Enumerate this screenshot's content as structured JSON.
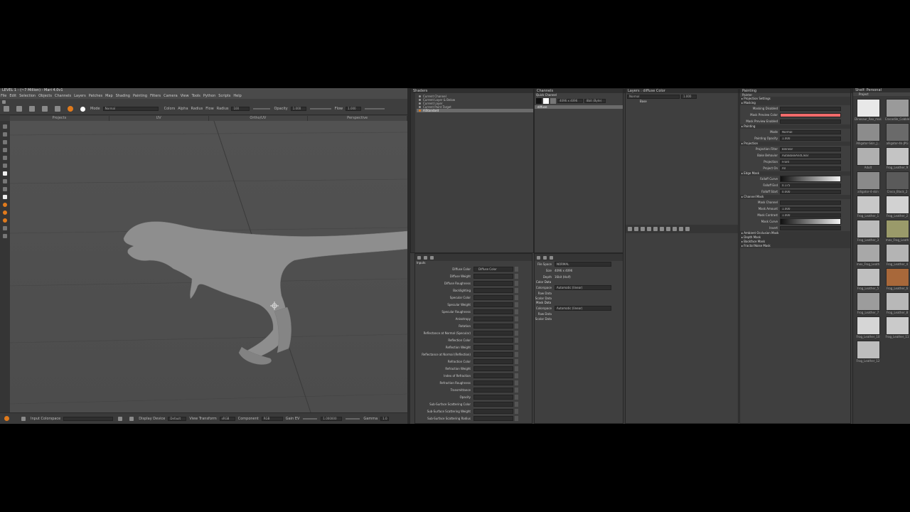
{
  "window": {
    "title": "LEVEL 1 - (~7 Million) - Mari 4.0v1"
  },
  "menu": [
    "File",
    "Edit",
    "Selection",
    "Objects",
    "Channels",
    "Layers",
    "Patches",
    "Map",
    "Shading",
    "Painting",
    "Filters",
    "Camera",
    "View",
    "Tools",
    "Python",
    "Scripts",
    "Help"
  ],
  "toolbar": {
    "mode_label": "Mode",
    "mode_value": "Normal",
    "colors_label": "Colors",
    "alpha_label": "Alpha",
    "radius_toggle_label": "Radius",
    "flow_toggle_label": "Flow",
    "radius_label": "Radius",
    "radius_value": "100",
    "opacity_label": "Opacity",
    "opacity_value": "1.000",
    "flow_label": "Flow",
    "flow_value": "1.000"
  },
  "view_tabs": [
    "Projects",
    "UV",
    "Ortho/UV",
    "Perspective"
  ],
  "statusbar": {
    "input_colorspace_label": "Input Colorspace",
    "display_device_label": "Display Device",
    "display_device_value": "Default",
    "view_transform_label": "View Transform",
    "view_transform_value": "sRGB",
    "component_label": "Component",
    "component_value": "RGB",
    "gain_label": "Gain EV",
    "gain_value": "1.000000",
    "gamma_label": "Gamma",
    "gamma_value": "1.0"
  },
  "shaders_panel": {
    "title": "Shaders",
    "items": [
      "Current Channel",
      "Current Layer & Below",
      "Current Layer",
      "Current Paint Target",
      "AiStandard"
    ],
    "selected_index": 4
  },
  "properties": {
    "section": "Inputs",
    "rows": [
      {
        "label": "Diffuse Color",
        "value": "Diffuse Color"
      },
      {
        "label": "Diffuse Weight",
        "value": ""
      },
      {
        "label": "Diffuse Roughness",
        "value": ""
      },
      {
        "label": "Backlighting",
        "value": ""
      },
      {
        "label": "Specular Color",
        "value": ""
      },
      {
        "label": "Specular Weight",
        "value": ""
      },
      {
        "label": "Specular Roughness",
        "value": ""
      },
      {
        "label": "Anisotropy",
        "value": ""
      },
      {
        "label": "Rotation",
        "value": ""
      },
      {
        "label": "Reflectance at Normal (Specular)",
        "value": ""
      },
      {
        "label": "Reflection Color",
        "value": ""
      },
      {
        "label": "Reflection Weight",
        "value": ""
      },
      {
        "label": "Reflectance at Normal (Reflection)",
        "value": ""
      },
      {
        "label": "Refraction Color",
        "value": ""
      },
      {
        "label": "Refraction Weight",
        "value": ""
      },
      {
        "label": "Index of Refraction",
        "value": ""
      },
      {
        "label": "Refraction Roughness",
        "value": ""
      },
      {
        "label": "Transmittance",
        "value": ""
      },
      {
        "label": "Opacity",
        "value": ""
      },
      {
        "label": "Sub-Surface Scattering Color",
        "value": ""
      },
      {
        "label": "Sub-Surface Scattering Weight",
        "value": ""
      },
      {
        "label": "Sub-Surface Scattering Radius",
        "value": ""
      }
    ]
  },
  "channels_panel": {
    "title": "Channels",
    "quick_channel_label": "Quick Channel",
    "size_value": "4096 x 4096",
    "depth_value": "8bit (Byte)",
    "channel_item": "diffuse"
  },
  "channel_props": {
    "file_space_label": "File Space",
    "file_space_value": "NORMAL",
    "size_label": "Size",
    "size_value": "4096 x 4096",
    "depth_label": "Depth",
    "depth_value": "16bit (Half)",
    "color_data_label": "Color Data",
    "colorspace_label": "Colorspace",
    "colorspace_value": "Automatic (linear)",
    "raw_data_label": "Raw Data",
    "scalar_data_label": "Scalar Data",
    "mask_data_label": "Mask Data",
    "mask_colorspace_value": "Automatic (linear)"
  },
  "layers_panel": {
    "title": "Layers : diffuse Color",
    "blend_label": "Normal",
    "opacity_value": "1.000",
    "layer_name": "Base"
  },
  "painting_panel": {
    "title": "Painting",
    "subtitle": "Painter",
    "sections": [
      {
        "name": "Projection Settings",
        "rows": []
      },
      {
        "name": "Masking",
        "rows": [
          {
            "label": "Masking Disabled",
            "value": ""
          },
          {
            "label": "Mask Preview Color",
            "value": "",
            "swatch": "#f26b6b"
          },
          {
            "label": "Mask Preview Enabled",
            "value": ""
          }
        ]
      },
      {
        "name": "Painting",
        "rows": [
          {
            "label": "Mode",
            "value": "Normal"
          },
          {
            "label": "Painting Opacity",
            "value": "1.000"
          }
        ]
      },
      {
        "name": "Projection",
        "rows": [
          {
            "label": "Projection Filter",
            "value": "Bilinear"
          },
          {
            "label": "Bake Behavior",
            "value": "AutoBakeAndClear"
          },
          {
            "label": "Projection",
            "value": "Front"
          },
          {
            "label": "Project On",
            "value": "All"
          }
        ]
      },
      {
        "name": "Edge Mask",
        "rows": [
          {
            "label": "Falloff Curve",
            "value": "",
            "gradient": true
          },
          {
            "label": "Falloff End",
            "value": "0.175"
          },
          {
            "label": "Falloff Start",
            "value": "0.000"
          }
        ]
      },
      {
        "name": "Channel Mask",
        "rows": [
          {
            "label": "Mask Channel",
            "value": ""
          },
          {
            "label": "Mask Amount",
            "value": "1.000"
          },
          {
            "label": "Mask Contrast",
            "value": "1.000"
          },
          {
            "label": "Mask Curve",
            "value": "",
            "gradient": true
          },
          {
            "label": "Invert",
            "value": ""
          }
        ]
      },
      {
        "name": "Ambient Occlusion Mask",
        "rows": []
      },
      {
        "name": "Depth Mask",
        "rows": []
      },
      {
        "name": "Backface Mask",
        "rows": []
      },
      {
        "name": "Fractal Noise Mask",
        "rows": []
      }
    ]
  },
  "shelf": {
    "title": "Shelf: Personal",
    "tab": "Project",
    "items": [
      {
        "name": "Dinosaur_Rex_mask",
        "color": "#e8e8e8"
      },
      {
        "name": "Crocodile_Cobble",
        "color": "#9a9a9a"
      },
      {
        "name": "Alligator-Skin_J...",
        "color": "#8c8c8c"
      },
      {
        "name": "alligator-4k-JPG",
        "color": "#6a6a6a"
      },
      {
        "name": "Adult",
        "color": "#b0b0b0"
      },
      {
        "name": "Frog_Leather_9",
        "color": "#c4c4c4"
      },
      {
        "name": "alligator-4-skin",
        "color": "#8a8a8a"
      },
      {
        "name": "Croco_Black_2",
        "color": "#5a5a5a"
      },
      {
        "name": "Frog_Leather_1",
        "color": "#c8c8c8"
      },
      {
        "name": "Frog_Leather_2",
        "color": "#d2d2d2"
      },
      {
        "name": "Frog_Leather_3",
        "color": "#bcbcbc"
      },
      {
        "name": "mex_Frog_Leath",
        "color": "#9a9a6a"
      },
      {
        "name": "mex_Frog_Leath",
        "color": "#a8a8a8"
      },
      {
        "name": "Frog_Leather_4",
        "color": "#b4b4b4"
      },
      {
        "name": "Frog_Leather_5",
        "color": "#c0c0c0"
      },
      {
        "name": "Frog_Leather_6",
        "color": "#a8683a"
      },
      {
        "name": "Frog_Leather_7",
        "color": "#9c9c9c"
      },
      {
        "name": "Frog_Leather_8",
        "color": "#b8b8b8"
      },
      {
        "name": "Frog_Leather_10",
        "color": "#d6d6d6"
      },
      {
        "name": "Frog_Leather_11",
        "color": "#cacaca"
      },
      {
        "name": "Frog_Leather_12",
        "color": "#bdbdbd"
      }
    ]
  }
}
